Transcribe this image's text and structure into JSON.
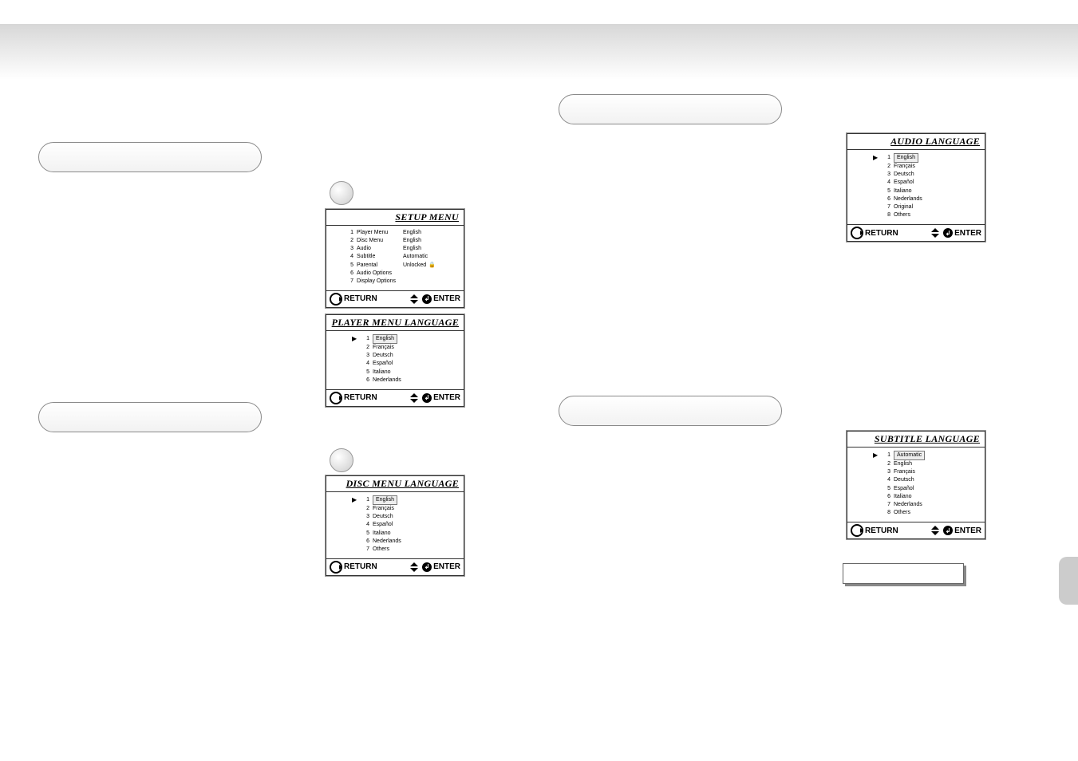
{
  "titles": {
    "setup_menu": "SETUP MENU",
    "player_menu_lang": "PLAYER MENU LANGUAGE",
    "disc_menu_lang": "DISC MENU LANGUAGE",
    "audio_lang": "AUDIO LANGUAGE",
    "subtitle_lang": "SUBTITLE LANGUAGE"
  },
  "footer": {
    "return": "RETURN",
    "enter": "ENTER"
  },
  "setup_menu": {
    "items": [
      {
        "n": "1",
        "label": "Player Menu",
        "value": "English"
      },
      {
        "n": "2",
        "label": "Disc Menu",
        "value": "English"
      },
      {
        "n": "3",
        "label": "Audio",
        "value": "English"
      },
      {
        "n": "4",
        "label": "Subtitle",
        "value": "Automatic"
      },
      {
        "n": "5",
        "label": "Parental",
        "value": "Unlocked"
      },
      {
        "n": "6",
        "label": "Audio Options",
        "value": ""
      },
      {
        "n": "7",
        "label": "Display Options",
        "value": ""
      }
    ]
  },
  "player_menu_lang": {
    "items": [
      {
        "n": "1",
        "label": "English"
      },
      {
        "n": "2",
        "label": "Français"
      },
      {
        "n": "3",
        "label": "Deutsch"
      },
      {
        "n": "4",
        "label": "Español"
      },
      {
        "n": "5",
        "label": "Italiano"
      },
      {
        "n": "6",
        "label": "Nederlands"
      }
    ]
  },
  "disc_menu_lang": {
    "items": [
      {
        "n": "1",
        "label": "English"
      },
      {
        "n": "2",
        "label": "Français"
      },
      {
        "n": "3",
        "label": "Deutsch"
      },
      {
        "n": "4",
        "label": "Español"
      },
      {
        "n": "5",
        "label": "Italiano"
      },
      {
        "n": "6",
        "label": "Nederlands"
      },
      {
        "n": "7",
        "label": "Others"
      }
    ]
  },
  "audio_lang": {
    "items": [
      {
        "n": "1",
        "label": "English"
      },
      {
        "n": "2",
        "label": "Français"
      },
      {
        "n": "3",
        "label": "Deutsch"
      },
      {
        "n": "4",
        "label": "Español"
      },
      {
        "n": "5",
        "label": "Italiano"
      },
      {
        "n": "6",
        "label": "Nederlands"
      },
      {
        "n": "7",
        "label": "Original"
      },
      {
        "n": "8",
        "label": "Others"
      }
    ]
  },
  "subtitle_lang": {
    "items": [
      {
        "n": "1",
        "label": "Automatic"
      },
      {
        "n": "2",
        "label": "English"
      },
      {
        "n": "3",
        "label": "Français"
      },
      {
        "n": "4",
        "label": "Deutsch"
      },
      {
        "n": "5",
        "label": "Español"
      },
      {
        "n": "6",
        "label": "Italiano"
      },
      {
        "n": "7",
        "label": "Nederlands"
      },
      {
        "n": "8",
        "label": "Others"
      }
    ]
  }
}
